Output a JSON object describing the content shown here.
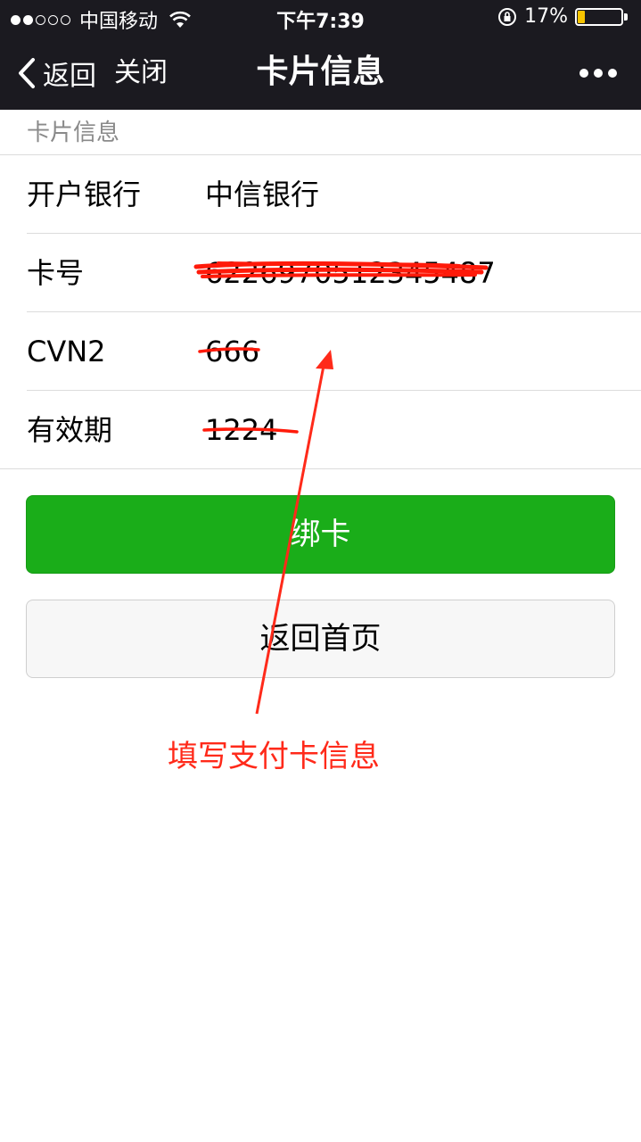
{
  "status_bar": {
    "carrier": "中国移动",
    "signal_bars_filled": 2,
    "signal_bars_total": 5,
    "time": "下午7:39",
    "battery_percent": "17%",
    "battery_level": 0.17,
    "battery_color": "#f7c400"
  },
  "nav": {
    "back_label": "返回",
    "close_label": "关闭",
    "title": "卡片信息",
    "more_icon": "more-dots-icon",
    "background": "#1b1a20"
  },
  "section": {
    "header": "卡片信息"
  },
  "rows": [
    {
      "label": "开户银行",
      "value": "中信银行"
    },
    {
      "label": "卡号",
      "value": "6226970512345487"
    },
    {
      "label": "CVN2",
      "value": "666"
    },
    {
      "label": "有效期",
      "value": "1224"
    }
  ],
  "buttons": {
    "bind_label": "绑卡",
    "home_label": "返回首页",
    "primary_color": "#1aad19"
  },
  "annotation": {
    "text": "填写支付卡信息",
    "color": "#ff2a1a"
  }
}
